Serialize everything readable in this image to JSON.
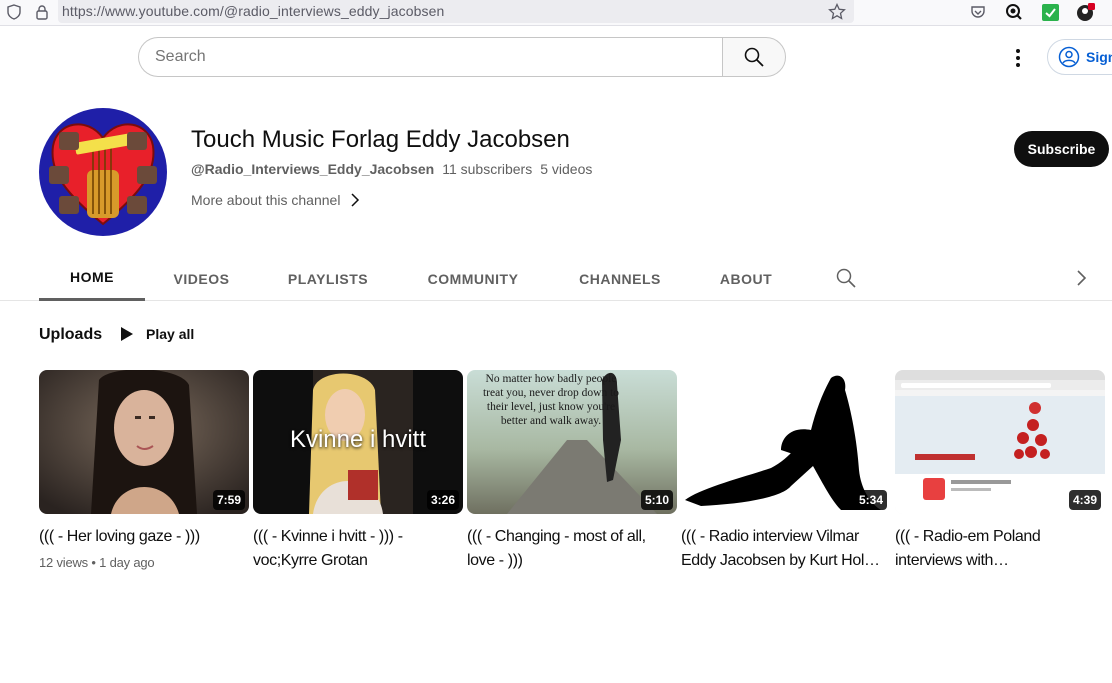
{
  "browser": {
    "url": "https://www.youtube.com/@radio_interviews_eddy_jacobsen"
  },
  "header": {
    "search_placeholder": "Search",
    "signin_label": "Sign in"
  },
  "channel": {
    "title": "Touch Music Forlag Eddy Jacobsen",
    "handle": "@Radio_Interviews_Eddy_Jacobsen",
    "subscribers": "11 subscribers",
    "videos": "5 videos",
    "more_about": "More about this channel",
    "subscribe_label": "Subscribe"
  },
  "tabs": [
    {
      "label": "HOME",
      "active": true
    },
    {
      "label": "VIDEOS"
    },
    {
      "label": "PLAYLISTS"
    },
    {
      "label": "COMMUNITY"
    },
    {
      "label": "CHANNELS"
    },
    {
      "label": "ABOUT"
    }
  ],
  "uploads": {
    "title": "Uploads",
    "play_all": "Play all",
    "videos": [
      {
        "title": "((( - Her loving gaze - )))",
        "duration": "7:59",
        "meta": "12 views • 1 day ago"
      },
      {
        "title": "((( - Kvinne i hvitt - ))) - voc;Kyrre Grotan",
        "duration": "3:26",
        "thumb_text": "Kvinne i hvitt"
      },
      {
        "title": "((( - Changing - most of all, love - )))",
        "duration": "5:10",
        "thumb_text": "No matter how badly people treat you, never drop down to their level, just know you're better and walk away."
      },
      {
        "title": "((( - Radio interview Vilmar Eddy Jacobsen by Kurt Hol…",
        "duration": "5:34"
      },
      {
        "title": "((( - Radio-em Poland interviews with…",
        "duration": "4:39"
      }
    ]
  },
  "colors": {
    "subscribe_bg": "#0f0f0f",
    "link_blue": "#065fd4",
    "meta_gray": "#606060"
  }
}
